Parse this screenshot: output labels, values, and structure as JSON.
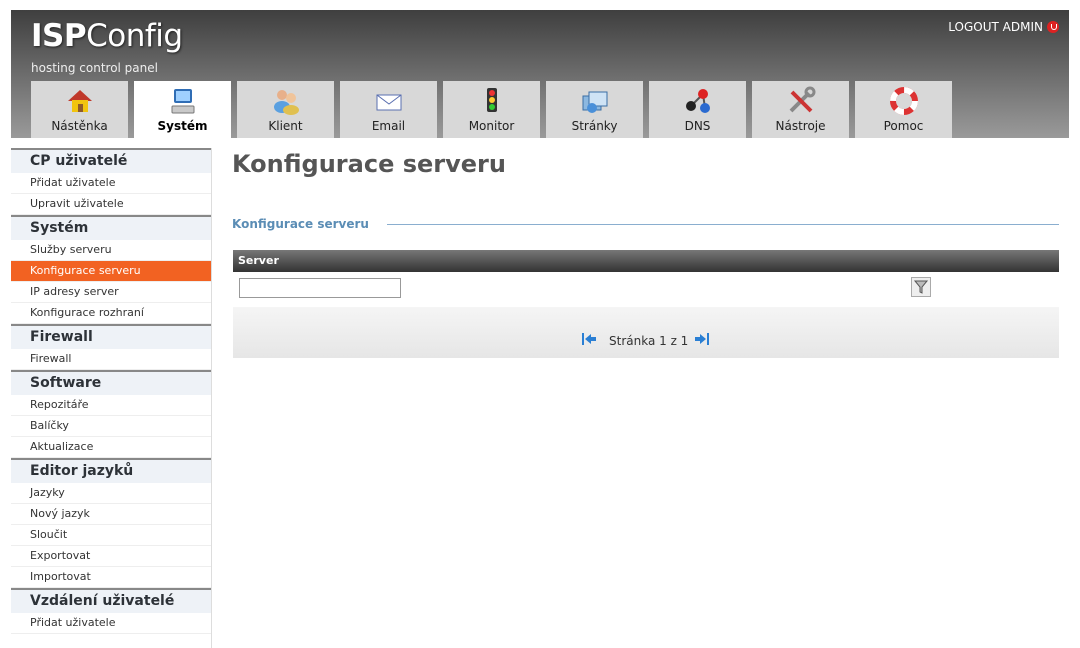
{
  "header": {
    "logo_bold": "ISP",
    "logo_rest": "Config",
    "tagline": "hosting control panel",
    "logout_label": "LOGOUT ADMIN"
  },
  "tabs": [
    {
      "label": "Nástěnka",
      "icon": "home-icon"
    },
    {
      "label": "Systém",
      "icon": "computer-icon",
      "active": true
    },
    {
      "label": "Klient",
      "icon": "users-icon"
    },
    {
      "label": "Email",
      "icon": "envelope-icon"
    },
    {
      "label": "Monitor",
      "icon": "traffic-light-icon"
    },
    {
      "label": "Stránky",
      "icon": "folders-icon"
    },
    {
      "label": "DNS",
      "icon": "network-icon"
    },
    {
      "label": "Nástroje",
      "icon": "tools-icon"
    },
    {
      "label": "Pomoc",
      "icon": "lifebuoy-icon"
    }
  ],
  "sidebar": {
    "sections": [
      {
        "title": "CP uživatelé",
        "items": [
          "Přidat uživatele",
          "Upravit uživatele"
        ]
      },
      {
        "title": "Systém",
        "items": [
          "Služby serveru",
          "Konfigurace serveru",
          "IP adresy server",
          "Konfigurace rozhraní"
        ]
      },
      {
        "title": "Firewall",
        "items": [
          "Firewall"
        ]
      },
      {
        "title": "Software",
        "items": [
          "Repozitáře",
          "Balíčky",
          "Aktualizace"
        ]
      },
      {
        "title": "Editor jazyků",
        "items": [
          "Jazyky",
          "Nový jazyk",
          "Sloučit",
          "Exportovat",
          "Importovat"
        ]
      },
      {
        "title": "Vzdálení uživatelé",
        "items": [
          "Přidat uživatele"
        ]
      }
    ],
    "active_item": "Konfigurace serveru"
  },
  "main": {
    "title": "Konfigurace serveru",
    "fieldset_legend": "Konfigurace serveru",
    "table": {
      "column_header": "Server",
      "filter_value": ""
    },
    "pager": {
      "text": "Stránka 1 z 1"
    }
  },
  "colors": {
    "active_item": "#f26222",
    "legend": "#5b8db5",
    "header_bg": "#5e5e5e"
  }
}
